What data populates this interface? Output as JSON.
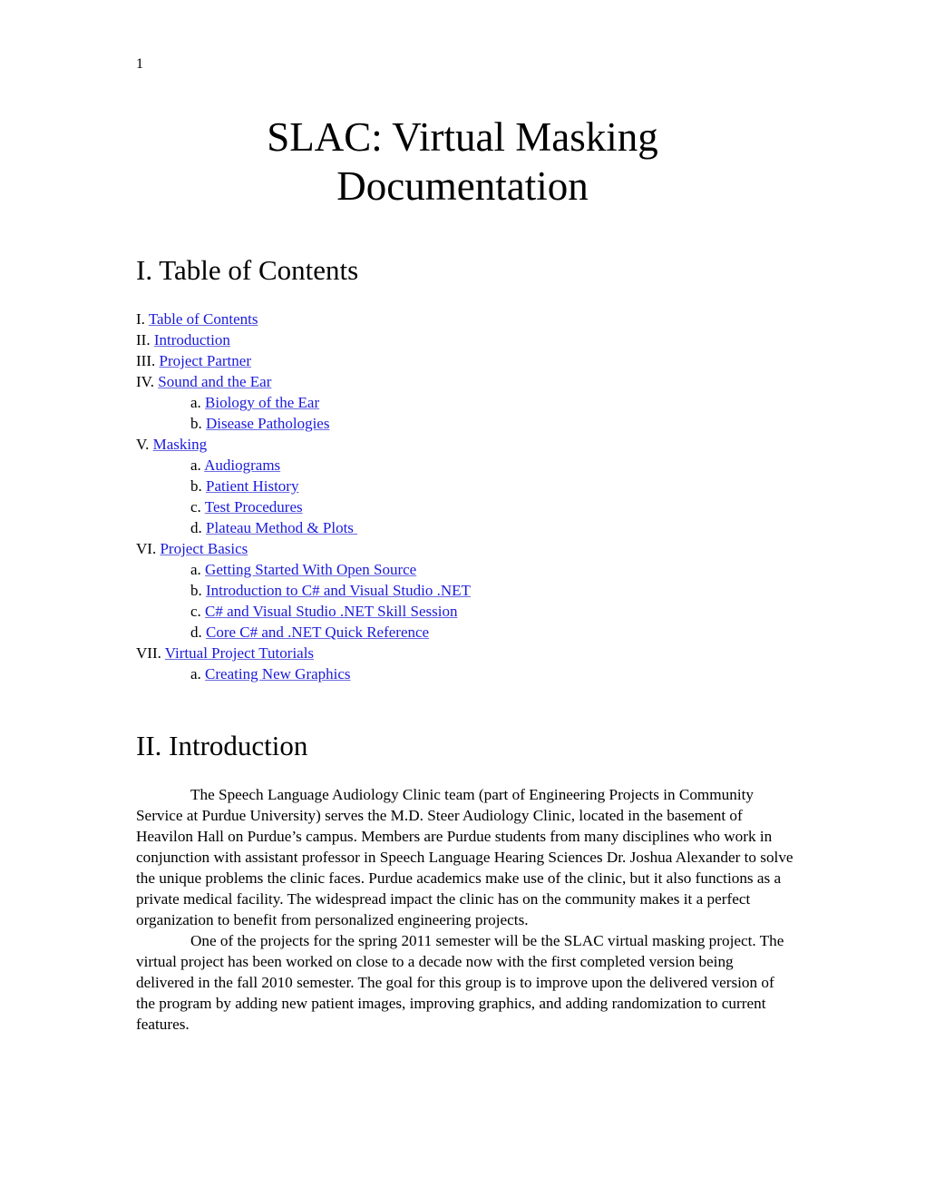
{
  "page_number": "1",
  "title_line1": "SLAC: Virtual Masking",
  "title_line2": "Documentation",
  "toc_heading": "I. Table of Contents",
  "toc": [
    {
      "prefix": "I. ",
      "label": "Table of Contents",
      "level": 0
    },
    {
      "prefix": "II. ",
      "label": "Introduction",
      "level": 0
    },
    {
      "prefix": "III. ",
      "label": "Project Partner",
      "level": 0
    },
    {
      "prefix": "IV. ",
      "label": "Sound and the Ear",
      "level": 0
    },
    {
      "prefix": "a. ",
      "label": "Biology of the Ear",
      "level": 1
    },
    {
      "prefix": "b. ",
      "label": "Disease Pathologies",
      "level": 1
    },
    {
      "prefix": "V. ",
      "label": "Masking",
      "level": 0
    },
    {
      "prefix": "a. ",
      "label": "Audiograms",
      "level": 1
    },
    {
      "prefix": "b. ",
      "label": "Patient History",
      "level": 1
    },
    {
      "prefix": "c. ",
      "label": "Test Procedures",
      "level": 1
    },
    {
      "prefix": "d. ",
      "label": "Plateau Method & Plots ",
      "level": 1
    },
    {
      "prefix": "VI. ",
      "label": "Project Basics",
      "level": 0
    },
    {
      "prefix": "a. ",
      "label": "Getting Started With Open Source",
      "level": 1
    },
    {
      "prefix": "b. ",
      "label": "Introduction to C# and Visual Studio .NET",
      "level": 1
    },
    {
      "prefix": "c. ",
      "label": "C# and Visual Studio .NET Skill Session",
      "level": 1
    },
    {
      "prefix": "d. ",
      "label": "Core C# and .NET Quick Reference",
      "level": 1
    },
    {
      "prefix": "VII. ",
      "label": "Virtual Project Tutorials",
      "level": 0
    },
    {
      "prefix": "a. ",
      "label": "Creating New Graphics",
      "level": 1
    }
  ],
  "intro_heading": "II. Introduction",
  "intro_paragraphs": [
    "The Speech Language Audiology Clinic team (part of Engineering Projects in Community Service at Purdue University) serves the M.D. Steer Audiology Clinic, located in the basement of Heavilon Hall on Purdue’s campus. Members are Purdue students from many disciplines who work in conjunction with assistant professor in Speech Language Hearing Sciences Dr. Joshua Alexander to solve the unique problems the clinic faces. Purdue academics make use of the clinic, but it also functions as a private medical facility. The widespread impact the clinic has on the community makes it a perfect organization to benefit from personalized engineering projects.",
    "One of the projects for the spring 2011 semester will be the SLAC virtual masking project. The virtual project has been worked on close to a decade now with the first completed version being delivered in the fall 2010 semester.  The goal for this group is to improve upon the delivered version of the program by adding new patient images, improving graphics, and adding randomization to current features."
  ]
}
